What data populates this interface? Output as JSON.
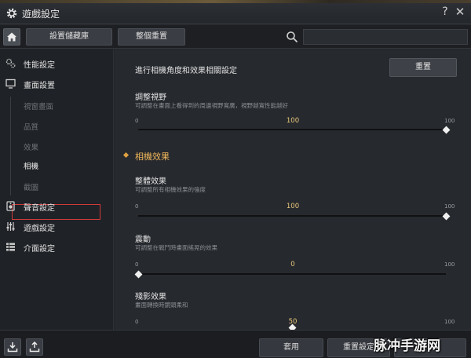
{
  "window": {
    "title": "遊戲設定",
    "help_glyph": "?",
    "close_glyph": "✕"
  },
  "toolbar": {
    "save_storage_label": "設置儲藏庫",
    "reset_all_label": "整個重置",
    "search_placeholder": ""
  },
  "sidebar": {
    "categories": [
      {
        "label": "性能設定",
        "icon": "performance-icon"
      },
      {
        "label": "畫面設置",
        "icon": "monitor-icon"
      },
      {
        "label": "聲音設定",
        "icon": "speaker-icon"
      },
      {
        "label": "遊戲設定",
        "icon": "sliders-icon"
      },
      {
        "label": "介面設定",
        "icon": "list-icon"
      }
    ],
    "sub_items": [
      "視窗畫面",
      "品質",
      "效果",
      "相機",
      "截圖"
    ],
    "active_sub_item": "相機"
  },
  "main": {
    "header": "進行相機角度和效果相關設定",
    "reset_label": "重置",
    "section_title": "相機效果",
    "settings": [
      {
        "title": "調整視野",
        "desc": "可調整在畫面上看得到的周邊視野寬廣，視野越寬性能越好",
        "min": "0",
        "max": "100",
        "value": "100",
        "fraction": 1.0
      },
      {
        "title": "整體效果",
        "desc": "可調整所有相機效果的強度",
        "min": "0",
        "max": "100",
        "value": "100",
        "fraction": 1.0
      },
      {
        "title": "震動",
        "desc": "可調整在戰鬥時畫面搖晃的效果",
        "min": "0",
        "max": "100",
        "value": "0",
        "fraction": 0.0
      },
      {
        "title": "殘影效果",
        "desc": "畫面轉換時鏡頭柔和",
        "min": "0",
        "max": "100",
        "value": "50",
        "fraction": 0.5
      }
    ]
  },
  "footer": {
    "apply_label": "套用",
    "reset_settings_label": "重置設定",
    "confirm_label": ""
  },
  "watermark": "脉冲手游网",
  "colors": {
    "accent_gold": "#f0b65a",
    "selection_red": "#d23a3a",
    "value_gold": "#e8c87a"
  }
}
